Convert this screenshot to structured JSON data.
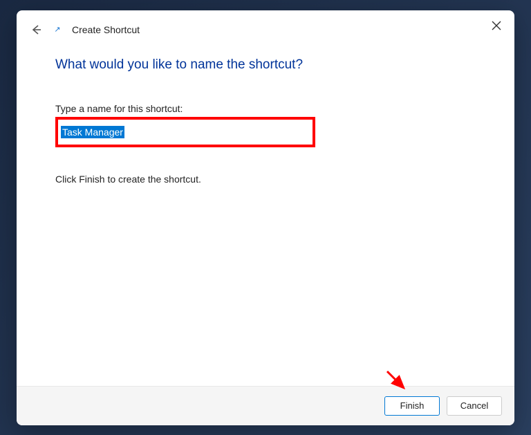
{
  "dialog": {
    "title": "Create Shortcut",
    "question": "What would you like to name the shortcut?",
    "fieldLabel": "Type a name for this shortcut:",
    "inputValue": "Task Manager",
    "instruction": "Click Finish to create the shortcut."
  },
  "buttons": {
    "finish": "Finish",
    "cancel": "Cancel"
  }
}
